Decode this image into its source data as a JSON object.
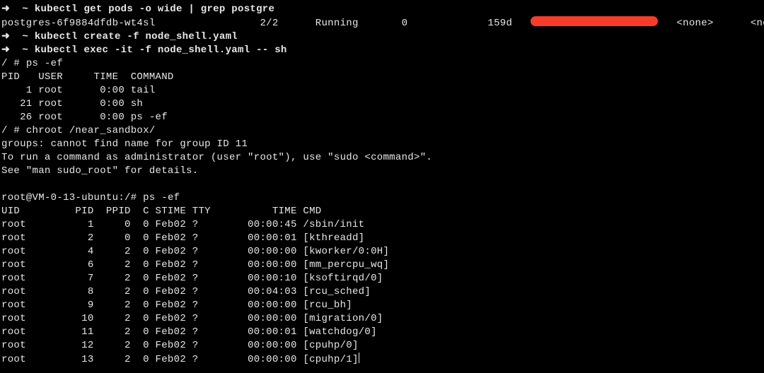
{
  "prompt_arrow_bold": "➜  ~ ",
  "prompt_arrow": "➜  ~ ",
  "cmd1": "kubectl get pods -o wide | grep postgre",
  "podrow": {
    "name": "postgres-6f9884dfdb-wt4sl",
    "ready": "2/2",
    "status": "Running",
    "restarts": "0",
    "age": "159d",
    "node": "<none>",
    "gates": "<none>"
  },
  "cmd2": "kubectl create -f node_shell.yaml",
  "cmd3": "kubectl exec -it -f node_shell.yaml -- sh",
  "shell_prompt": "/ # ",
  "cmd4": "ps -ef",
  "ps_mini_header": "PID   USER     TIME  COMMAND",
  "ps_mini_rows": [
    "    1 root      0:00 tail",
    "   21 root      0:00 sh",
    "   26 root      0:00 ps -ef"
  ],
  "cmd5": "chroot /near_sandbox/",
  "warn1": "groups: cannot find name for group ID 11",
  "warn2": "To run a command as administrator (user \"root\"), use \"sudo <command>\".",
  "warn3": "See \"man sudo_root\" for details.",
  "hostprompt": "root@VM-0-13-ubuntu:/# ",
  "cmd6": "ps -ef",
  "ps_header_cols": {
    "uid": "UID",
    "pid": "PID",
    "ppid": "PPID",
    "c": "C",
    "stime": "STIME",
    "tty": "TTY",
    "time": "TIME",
    "cmd": "CMD"
  },
  "ps_rows": [
    {
      "uid": "root",
      "pid": "1",
      "ppid": "0",
      "c": "0",
      "stime": "Feb02",
      "tty": "?",
      "time": "00:00:45",
      "cmd": "/sbin/init"
    },
    {
      "uid": "root",
      "pid": "2",
      "ppid": "0",
      "c": "0",
      "stime": "Feb02",
      "tty": "?",
      "time": "00:00:01",
      "cmd": "[kthreadd]"
    },
    {
      "uid": "root",
      "pid": "4",
      "ppid": "2",
      "c": "0",
      "stime": "Feb02",
      "tty": "?",
      "time": "00:00:00",
      "cmd": "[kworker/0:0H]"
    },
    {
      "uid": "root",
      "pid": "6",
      "ppid": "2",
      "c": "0",
      "stime": "Feb02",
      "tty": "?",
      "time": "00:00:00",
      "cmd": "[mm_percpu_wq]"
    },
    {
      "uid": "root",
      "pid": "7",
      "ppid": "2",
      "c": "0",
      "stime": "Feb02",
      "tty": "?",
      "time": "00:00:10",
      "cmd": "[ksoftirqd/0]"
    },
    {
      "uid": "root",
      "pid": "8",
      "ppid": "2",
      "c": "0",
      "stime": "Feb02",
      "tty": "?",
      "time": "00:04:03",
      "cmd": "[rcu_sched]"
    },
    {
      "uid": "root",
      "pid": "9",
      "ppid": "2",
      "c": "0",
      "stime": "Feb02",
      "tty": "?",
      "time": "00:00:00",
      "cmd": "[rcu_bh]"
    },
    {
      "uid": "root",
      "pid": "10",
      "ppid": "2",
      "c": "0",
      "stime": "Feb02",
      "tty": "?",
      "time": "00:00:00",
      "cmd": "[migration/0]"
    },
    {
      "uid": "root",
      "pid": "11",
      "ppid": "2",
      "c": "0",
      "stime": "Feb02",
      "tty": "?",
      "time": "00:00:01",
      "cmd": "[watchdog/0]"
    },
    {
      "uid": "root",
      "pid": "12",
      "ppid": "2",
      "c": "0",
      "stime": "Feb02",
      "tty": "?",
      "time": "00:00:00",
      "cmd": "[cpuhp/0]"
    },
    {
      "uid": "root",
      "pid": "13",
      "ppid": "2",
      "c": "0",
      "stime": "Feb02",
      "tty": "?",
      "time": "00:00:00",
      "cmd": "[cpuhp/1]"
    }
  ]
}
